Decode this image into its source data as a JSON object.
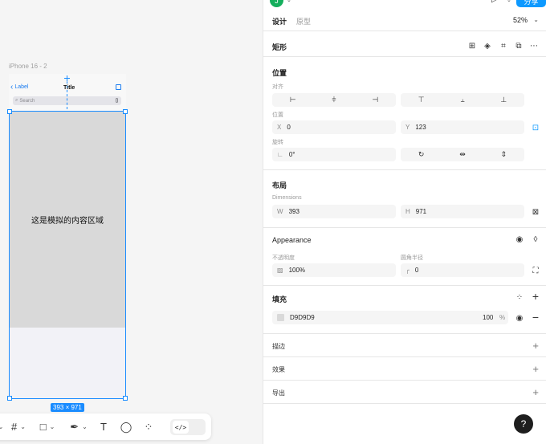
{
  "canvas": {
    "frame_label": "iPhone 16 - 2",
    "nav_back_label": "Label",
    "nav_title": "Title",
    "search_placeholder": "Search",
    "content_text": "这是模拟的内容区域",
    "size_badge": "393 × 971",
    "toolbar": {
      "frame_tool": "#",
      "shape_tool": "□",
      "pen_tool": "✒",
      "text_tool": "T",
      "comment_tool": "◯",
      "actions_tool": "⁘",
      "code_toggle": "</>"
    }
  },
  "header": {
    "avatar_letter": "J",
    "share_label": "分享",
    "tabs": [
      {
        "label": "设计",
        "active": true
      },
      {
        "label": "原型",
        "active": false
      }
    ],
    "zoom": "52%"
  },
  "selection": {
    "title": "矩形"
  },
  "position": {
    "title": "位置",
    "align_label": "对齐",
    "position_label": "位置",
    "x_prefix": "X",
    "x_value": "0",
    "y_prefix": "Y",
    "y_value": "123",
    "rotation_label": "旋转",
    "rotation_value": "0°"
  },
  "layout": {
    "title": "布局",
    "dimensions_label": "Dimensions",
    "w_prefix": "W",
    "w_value": "393",
    "h_prefix": "H",
    "h_value": "971"
  },
  "appearance": {
    "title": "Appearance",
    "opacity_label": "不透明度",
    "opacity_value": "100%",
    "radius_label": "圆角半径",
    "radius_value": "0"
  },
  "fill": {
    "title": "填充",
    "color_hex": "D9D9D9",
    "color_swatch": "#D9D9D9",
    "opacity": "100",
    "opacity_unit": "%"
  },
  "stroke": {
    "title": "描边"
  },
  "effects": {
    "title": "效果"
  },
  "export": {
    "title": "导出"
  },
  "colors": {
    "accent": "#0d99ff",
    "selection": "#1a8cff",
    "avatar": "#14ae5c"
  }
}
